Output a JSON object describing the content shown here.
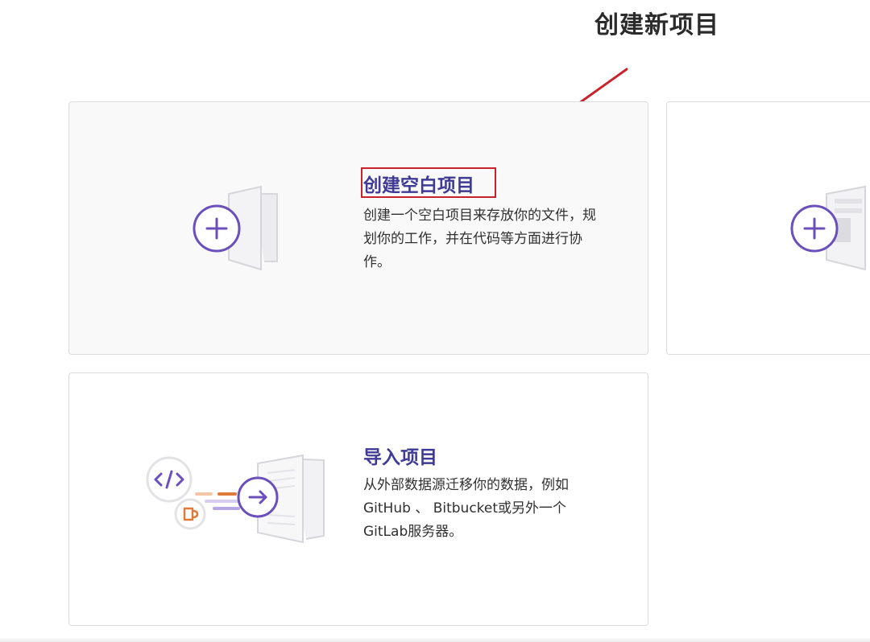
{
  "annotation": {
    "title": "创建新项目"
  },
  "cards": {
    "blank": {
      "title": "创建空白项目",
      "description": "创建一个空白项目来存放你的文件，规划你的工作，并在代码等方面进行协作。"
    },
    "import": {
      "title": "导入项目",
      "description": "从外部数据源迁移你的数据，例如GitHub 、 Bitbucket或另外一个GitLab服务器。"
    }
  },
  "colors": {
    "accent_purple": "#6b4fbb",
    "title_indigo": "#3f3a95",
    "annotation_red": "#c8232c",
    "card_bg_selected": "#f9f9fa",
    "orange": "#e07a3a"
  }
}
